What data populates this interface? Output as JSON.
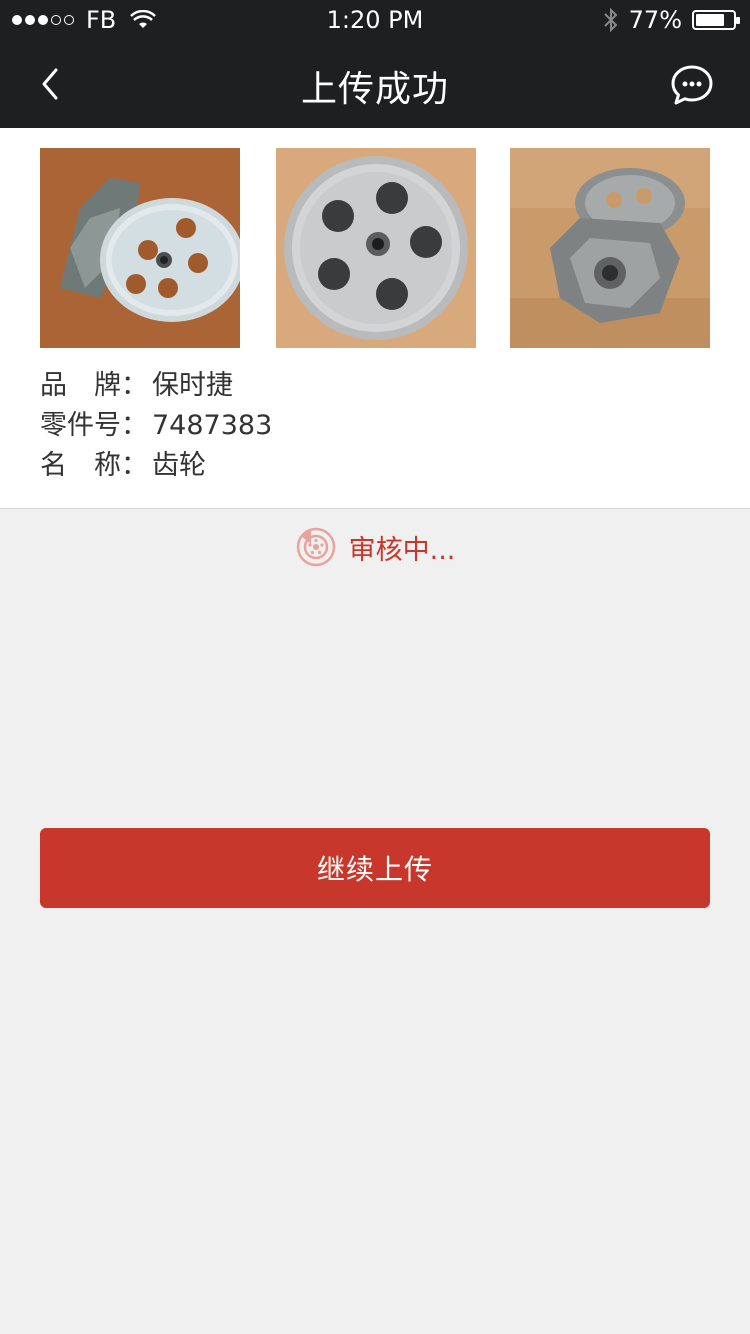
{
  "status_bar": {
    "carrier": "FB",
    "time": "1:20 PM",
    "battery_percent": "77%",
    "battery_level": 0.77,
    "signal_filled": 3,
    "signal_total": 5
  },
  "nav": {
    "title": "上传成功",
    "back_icon": "chevron-left-icon",
    "chat_icon": "chat-bubble-icon"
  },
  "photos": [
    {
      "alt": "pulley-pump-photo-1"
    },
    {
      "alt": "pulley-top-photo-2"
    },
    {
      "alt": "pump-side-photo-3"
    }
  ],
  "info": {
    "brand_label": "品　牌：",
    "brand_value": "保时捷",
    "part_label": "零件号：",
    "part_value": "7487383",
    "name_label": "名　称：",
    "name_value": "齿轮"
  },
  "review": {
    "status_text": "审核中...",
    "icon": "brake-disc-icon"
  },
  "actions": {
    "continue_label": "继续上传"
  },
  "colors": {
    "accent": "#c8372b",
    "nav_bg": "#1e1f21",
    "page_bg": "#f0f0f0"
  }
}
